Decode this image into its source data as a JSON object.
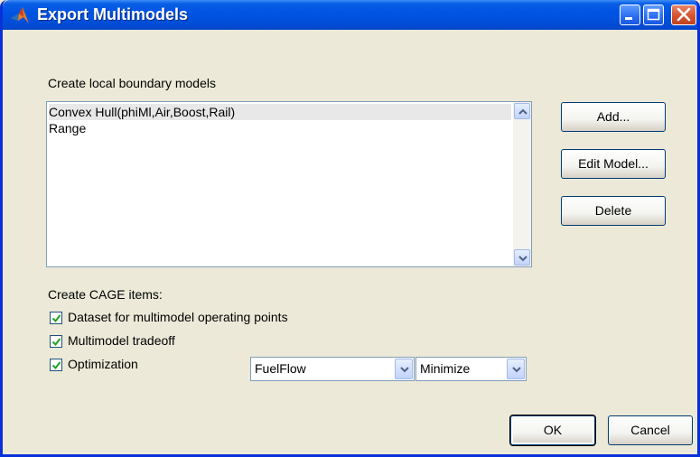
{
  "window": {
    "title": "Export Multimodels"
  },
  "boundary": {
    "heading": "Create local boundary models",
    "items": [
      "Convex Hull(phiMl,Air,Boost,Rail)",
      "Range"
    ]
  },
  "side_buttons": {
    "add": "Add...",
    "edit": "Edit Model...",
    "delete": "Delete"
  },
  "cage": {
    "heading": "Create CAGE items:",
    "dataset": {
      "label": "Dataset for multimodel operating points",
      "checked": true
    },
    "tradeoff": {
      "label": "Multimodel tradeoff",
      "checked": true
    },
    "optimization": {
      "label": "Optimization",
      "checked": true
    }
  },
  "optimization_options": {
    "objective": "FuelFlow",
    "direction": "Minimize"
  },
  "footer": {
    "ok": "OK",
    "cancel": "Cancel"
  },
  "icons": {
    "app": "matlab-icon",
    "minimize": "minimize-icon",
    "maximize": "maximize-icon",
    "close": "close-icon"
  }
}
